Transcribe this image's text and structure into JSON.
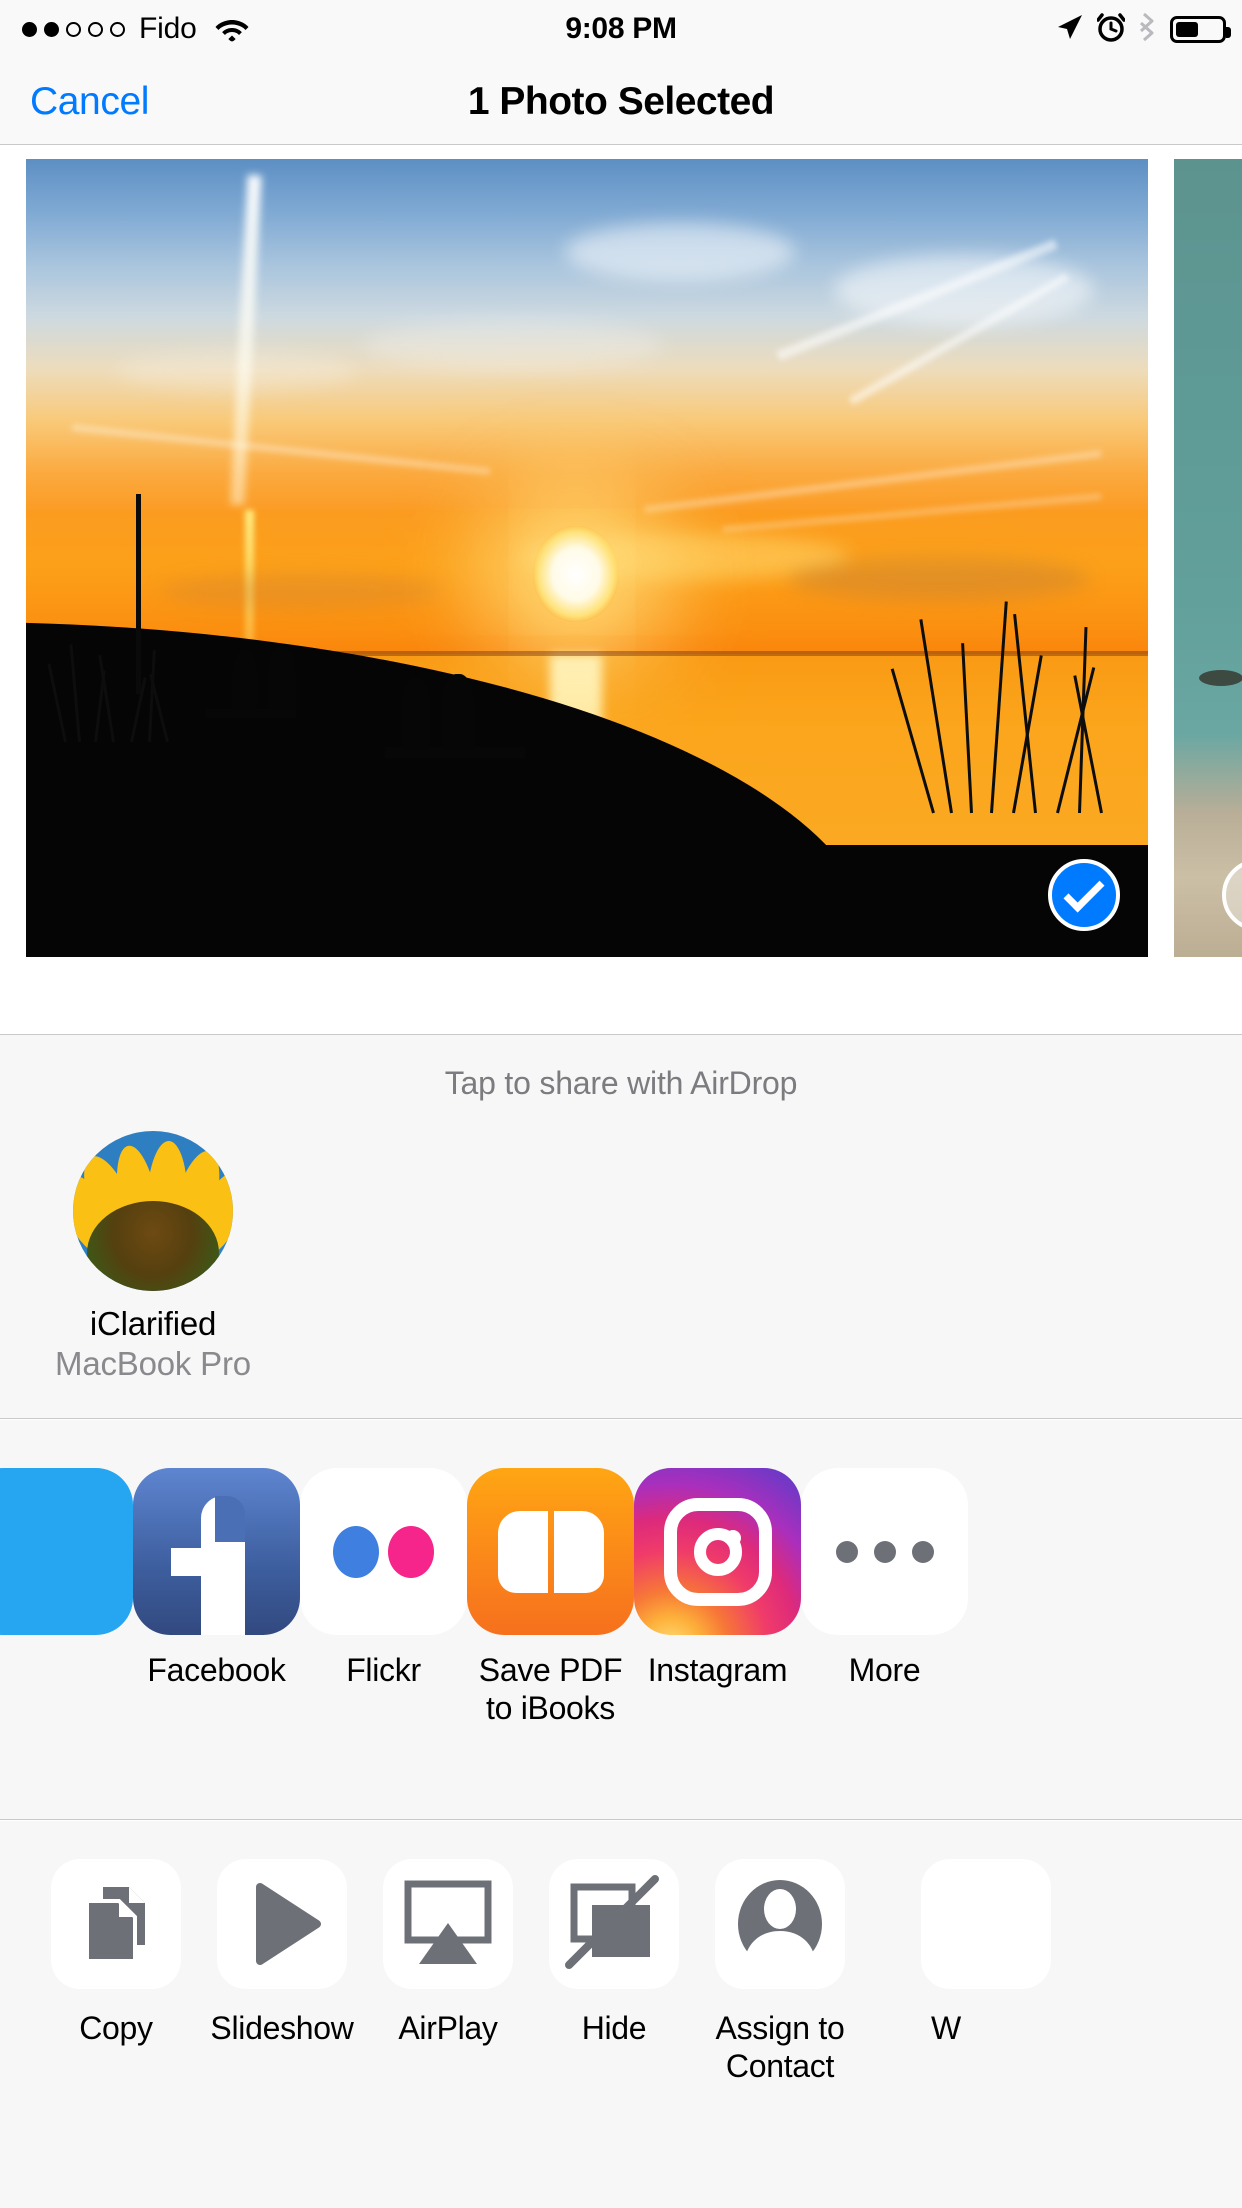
{
  "status_bar": {
    "carrier": "Fido",
    "signal_bars_filled": 2,
    "signal_bars_total": 5,
    "wifi_icon": "wifi-icon",
    "time": "9:08 PM",
    "location_icon": "location-arrow-icon",
    "alarm_icon": "alarm-clock-icon",
    "bluetooth_icon": "bluetooth-icon",
    "battery_icon": "battery-icon",
    "battery_percent": 50
  },
  "nav": {
    "cancel_label": "Cancel",
    "title": "1 Photo Selected"
  },
  "photo_strip": {
    "selected_badge_icon": "checkmark-circle-icon",
    "items": [
      {
        "name": "photo-thumbnail-previous",
        "selected": false,
        "partial": true
      },
      {
        "name": "photo-thumbnail-selected",
        "selected": true,
        "partial": false
      },
      {
        "name": "photo-thumbnail-next",
        "selected": false,
        "partial": true
      }
    ]
  },
  "airdrop": {
    "hint": "Tap to share with AirDrop",
    "contacts": [
      {
        "name": "iClarified",
        "device": "MacBook Pro",
        "avatar_icon": "sunflower-avatar"
      }
    ]
  },
  "app_row": {
    "items": [
      {
        "label": "",
        "icon": "twitter-icon",
        "partial": true
      },
      {
        "label": "Facebook",
        "icon": "facebook-icon",
        "partial": false
      },
      {
        "label": "Flickr",
        "icon": "flickr-icon",
        "partial": false
      },
      {
        "label": "Save PDF to iBooks",
        "icon": "ibooks-icon",
        "partial": false
      },
      {
        "label": "Instagram",
        "icon": "instagram-icon",
        "partial": false
      },
      {
        "label": "More",
        "icon": "more-ellipsis-icon",
        "partial": false
      }
    ]
  },
  "action_row": {
    "items": [
      {
        "label": "Copy",
        "icon": "copy-documents-icon"
      },
      {
        "label": "Slideshow",
        "icon": "play-triangle-icon"
      },
      {
        "label": "AirPlay",
        "icon": "airplay-icon"
      },
      {
        "label": "Hide",
        "icon": "hide-slashed-icon"
      },
      {
        "label": "Assign to Contact",
        "icon": "person-circle-icon"
      },
      {
        "label": "W",
        "icon": "wallpaper-icon"
      }
    ]
  },
  "colors": {
    "accent_blue": "#007AFF",
    "panel_bg": "#F7F7F7",
    "bar_bg": "#F9F9F9",
    "separator": "#C9C9CC",
    "glyph_gray": "#6E7078",
    "secondary_text": "#8A8A8E"
  }
}
